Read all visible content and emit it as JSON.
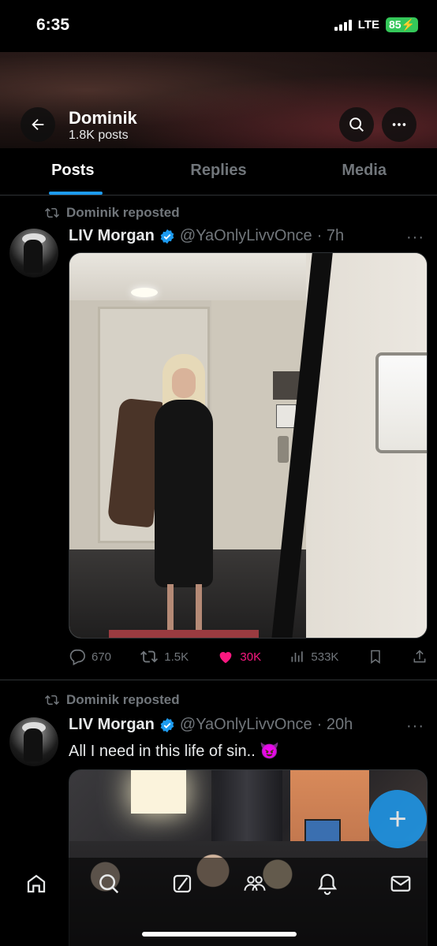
{
  "status_bar": {
    "time": "6:35",
    "network": "LTE",
    "battery": "85"
  },
  "header": {
    "name": "Dominik",
    "post_count": "1.8K posts"
  },
  "tabs": [
    {
      "label": "Posts",
      "active": true
    },
    {
      "label": "Replies",
      "active": false
    },
    {
      "label": "Media",
      "active": false
    }
  ],
  "posts": [
    {
      "repost_label": "Dominik reposted",
      "author": "LIV Morgan",
      "verified": true,
      "handle": "@YaOnlyLivvOnce",
      "time": "· 7h",
      "text": "",
      "replies": "670",
      "reposts": "1.5K",
      "likes": "30K",
      "views": "533K"
    },
    {
      "repost_label": "Dominik reposted",
      "author": "LIV Morgan",
      "verified": true,
      "handle": "@YaOnlyLivvOnce",
      "time": "· 20h",
      "text": "All I need in this life of sin.. 😈"
    }
  ],
  "fab_icon": "+",
  "colors": {
    "accent": "#1d9bf0",
    "like": "#f91880",
    "muted": "#71767b"
  }
}
